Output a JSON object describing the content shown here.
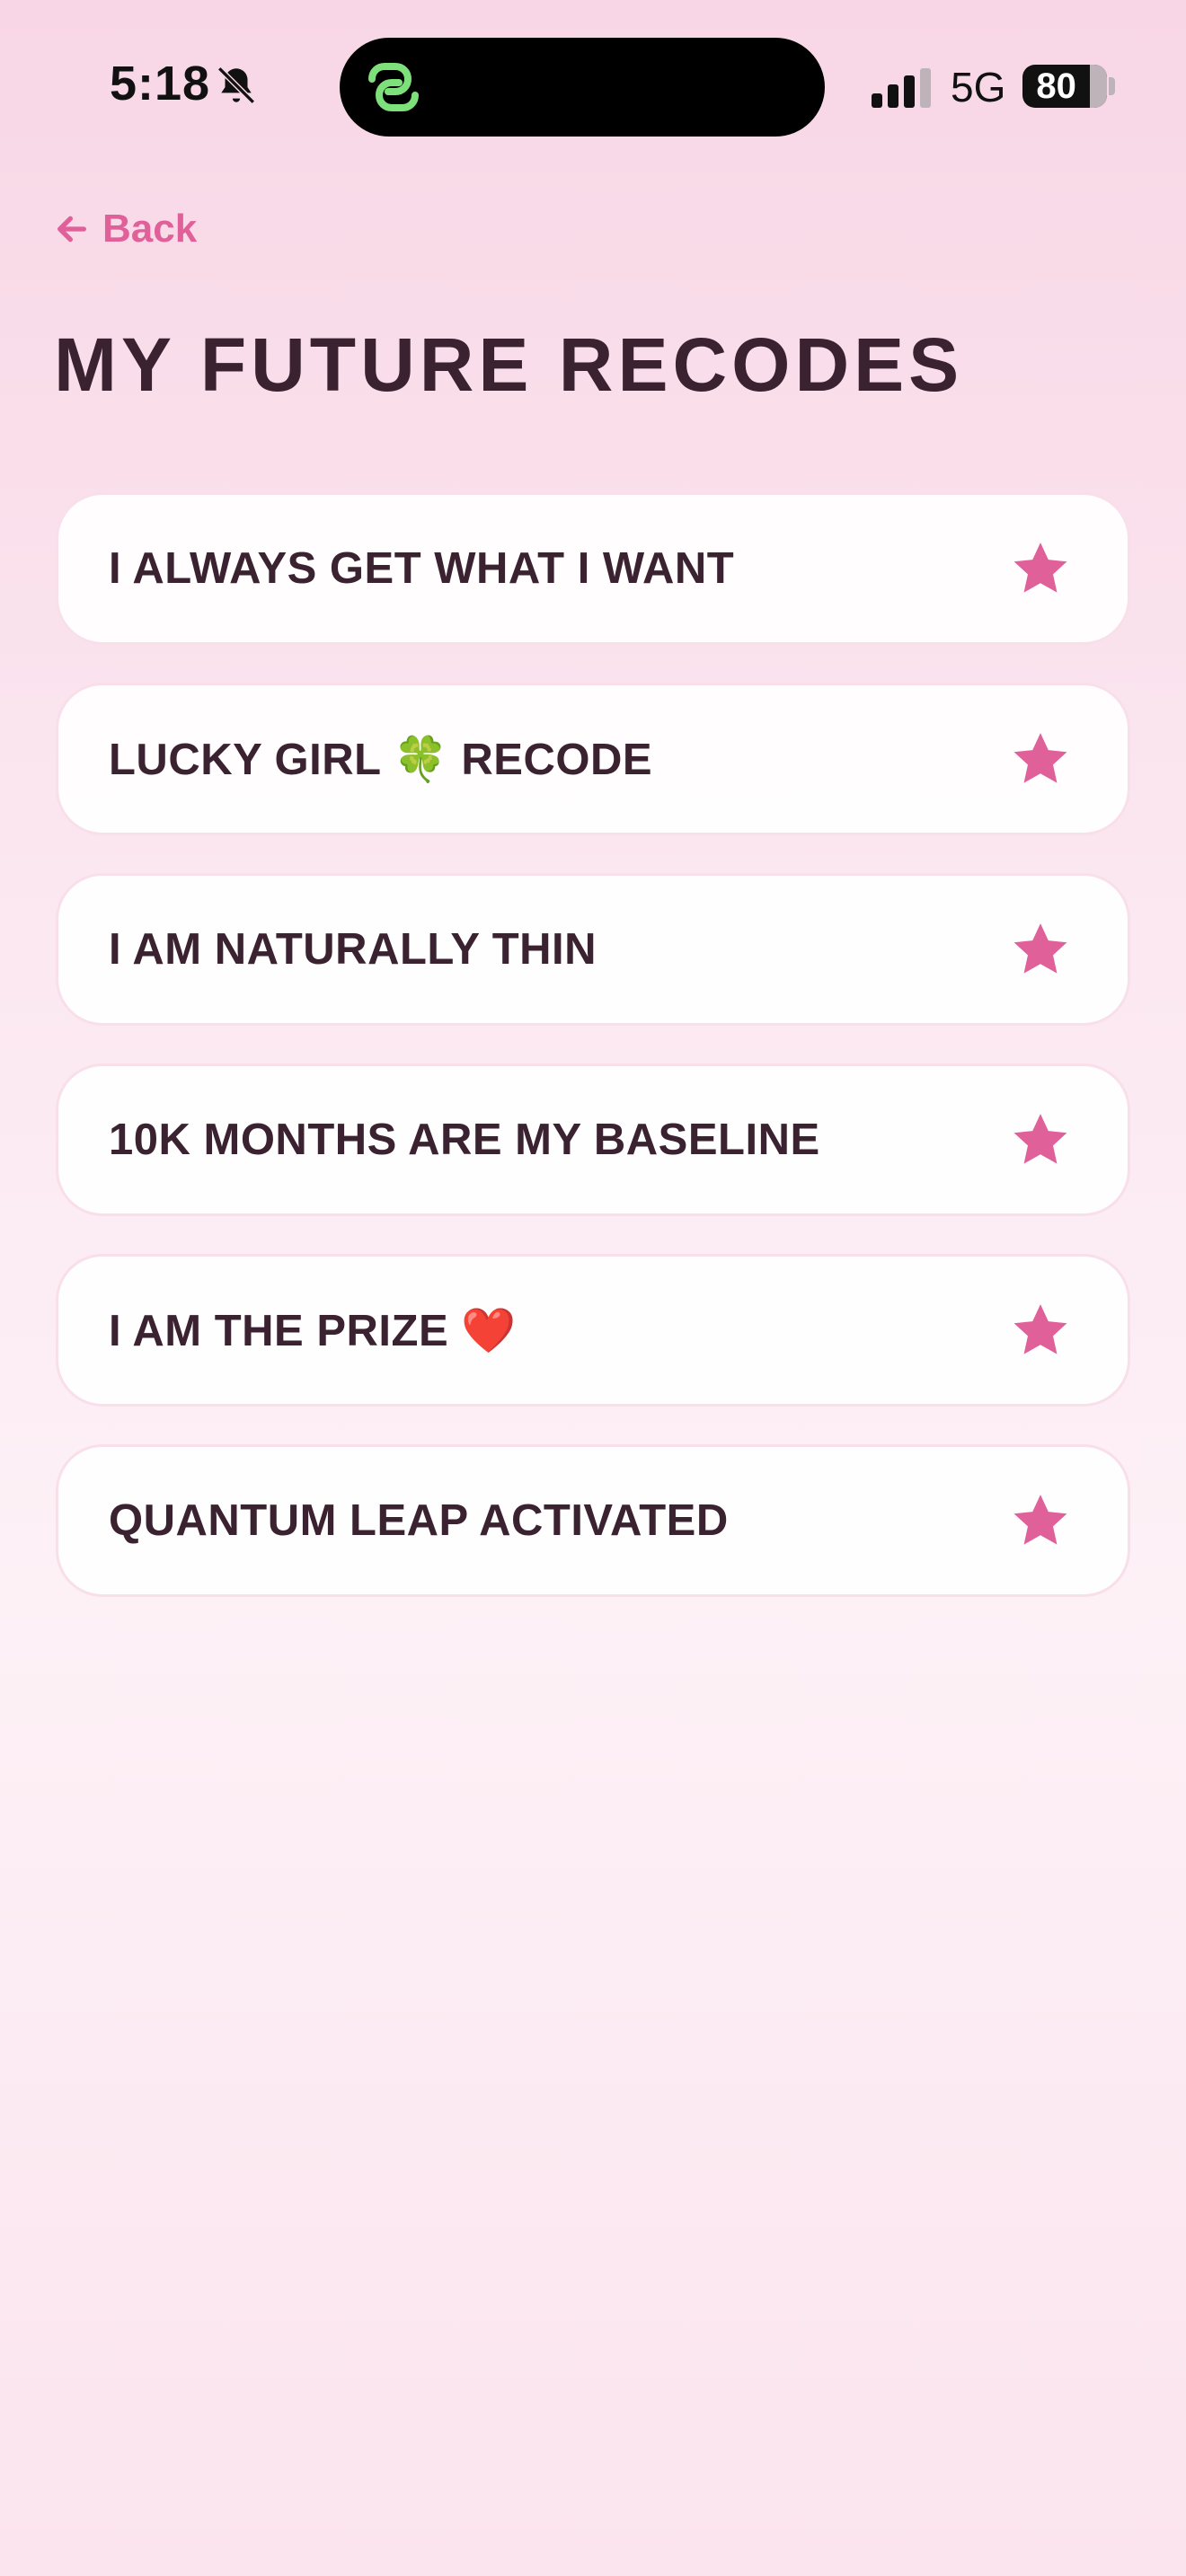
{
  "status_bar": {
    "time": "5:18",
    "network": "5G",
    "battery_level": "80"
  },
  "nav": {
    "back_label": "Back"
  },
  "page": {
    "title": "MY FUTURE RECODES"
  },
  "recodes": [
    {
      "label": "I ALWAYS GET WHAT I WANT",
      "favorite": true
    },
    {
      "label": "LUCKY GIRL 🍀 RECODE",
      "favorite": true
    },
    {
      "label": "I AM NATURALLY THIN",
      "favorite": true
    },
    {
      "label": "10K MONTHS ARE MY BASELINE",
      "favorite": true
    },
    {
      "label": "I AM THE PRIZE ❤️",
      "favorite": true
    },
    {
      "label": "QUANTUM LEAP ACTIVATED",
      "favorite": true
    }
  ],
  "colors": {
    "accent": "#e0609a",
    "text": "#3a2230",
    "island_icon": "#7ee07a"
  },
  "icons": {
    "status": [
      "bell-slash-icon",
      "link-icon",
      "signal-icon",
      "battery-icon"
    ],
    "nav": "arrow-left-icon",
    "card": "star-icon"
  }
}
